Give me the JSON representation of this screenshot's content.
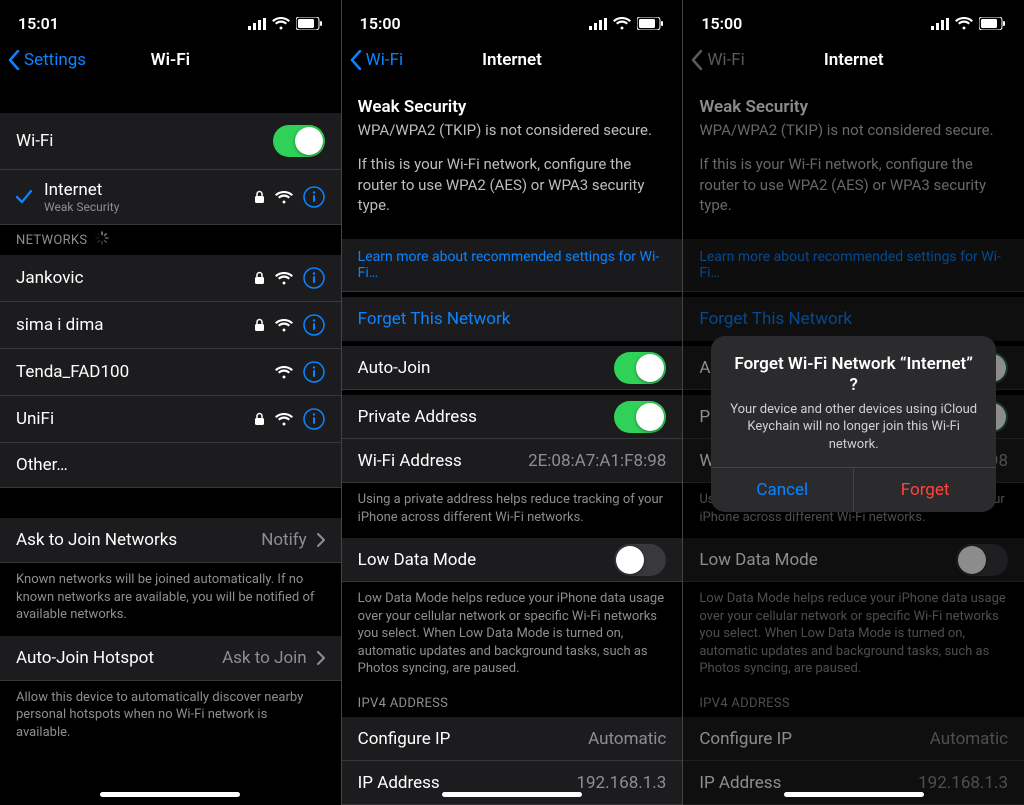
{
  "panels": {
    "left": {
      "status_time": "15:01",
      "back_label": "Settings",
      "nav_title": "Wi-Fi",
      "wifi_toggle_label": "Wi-Fi",
      "connected": {
        "name": "Internet",
        "subtitle": "Weak Security",
        "locked": true
      },
      "networks_header": "NETWORKS",
      "networks": [
        {
          "name": "Jankovic",
          "locked": true
        },
        {
          "name": "sima i dima",
          "locked": true
        },
        {
          "name": "Tenda_FAD100",
          "locked": false
        },
        {
          "name": "UniFi",
          "locked": true
        },
        {
          "name": "Other…",
          "locked": false,
          "other": true
        }
      ],
      "ask_join_label": "Ask to Join Networks",
      "ask_join_value": "Notify",
      "ask_join_footer": "Known networks will be joined automatically. If no known networks are available, you will be notified of available networks.",
      "auto_join_label": "Auto-Join Hotspot",
      "auto_join_value": "Ask to Join",
      "auto_join_footer": "Allow this device to automatically discover nearby personal hotspots when no Wi-Fi network is available."
    },
    "middle": {
      "status_time": "15:00",
      "back_label": "Wi-Fi",
      "nav_title": "Internet",
      "warn_title": "Weak Security",
      "warn_line1": "WPA/WPA2 (TKIP) is not considered secure.",
      "warn_line2": "If this is your Wi-Fi network, configure the router to use WPA2 (AES) or WPA3 security type.",
      "learn_more": "Learn more about recommended settings for Wi-Fi…",
      "forget": "Forget This Network",
      "auto_join": "Auto-Join",
      "private_addr": "Private Address",
      "wifi_addr_label": "Wi-Fi Address",
      "wifi_addr_value": "2E:08:A7:A1:F8:98",
      "private_footer": "Using a private address helps reduce tracking of your iPhone across different Wi-Fi networks.",
      "low_data": "Low Data Mode",
      "low_data_footer": "Low Data Mode helps reduce your iPhone data usage over your cellular network or specific Wi-Fi networks you select. When Low Data Mode is turned on, automatic updates and background tasks, such as Photos syncing, are paused.",
      "ipv4_header": "IPV4 ADDRESS",
      "configure_ip": "Configure IP",
      "configure_ip_value": "Automatic",
      "ip_addr_label": "IP Address",
      "ip_addr_value": "192.168.1.3"
    },
    "right": {
      "status_time": "15:00",
      "alert_title": "Forget Wi-Fi Network “Internet” ?",
      "alert_msg": "Your device and other devices using iCloud Keychain will no longer join this Wi-Fi network.",
      "cancel": "Cancel",
      "forget": "Forget"
    }
  }
}
